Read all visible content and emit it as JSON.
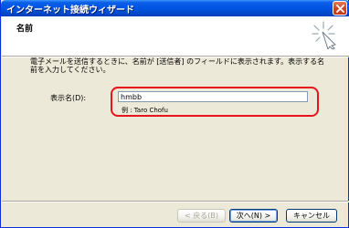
{
  "window": {
    "title": "インターネット接続ウィザード"
  },
  "header": {
    "title": "名前",
    "icon": "wizard-sparkle-icon"
  },
  "instruction": "電子メールを送信するときに、名前が [送信者] のフィールドに表示されます。表示する名前を入力してください。",
  "form": {
    "display_name_label": "表示名(D):",
    "display_name_value": "hmbb",
    "example": "例 : Taro Chofu"
  },
  "buttons": {
    "back": "< 戻る(B)",
    "next": "次へ(N) >",
    "cancel": "キャンセル"
  },
  "colors": {
    "highlight": "#e8141b",
    "titlebar": "#0054e3",
    "dialog_bg": "#ece9d8"
  }
}
